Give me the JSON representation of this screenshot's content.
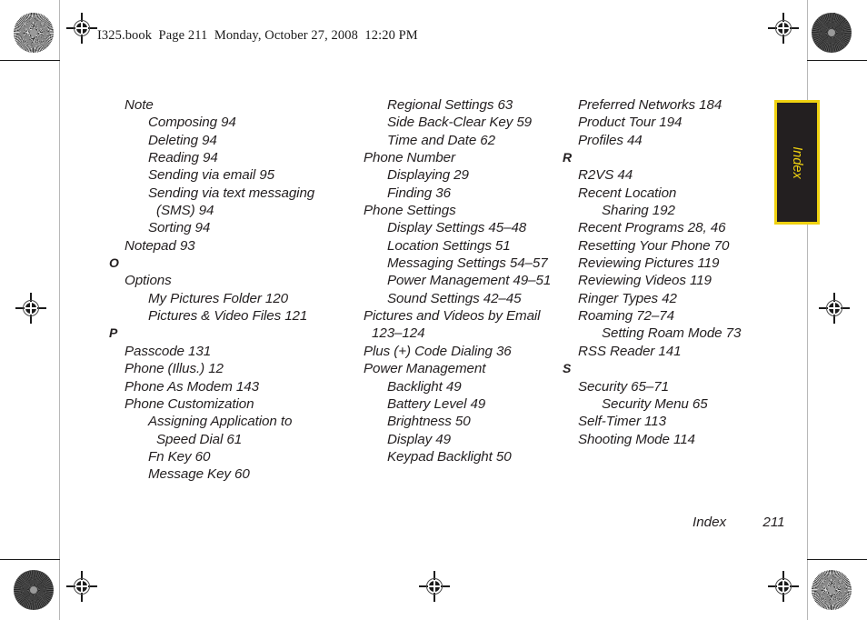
{
  "page": {
    "header_slug": "I325.book  Page 211  Monday, October 27, 2008  12:20 PM",
    "thumb_tab_label": "Index",
    "footer_section": "Index",
    "footer_page_number": "211",
    "colors": {
      "tab_background": "#231f20",
      "tab_border": "#efd110",
      "tab_text": "#efd110",
      "body_text": "#231f20"
    }
  },
  "columns": [
    {
      "id": "column-1",
      "blocks": [
        {
          "type": "entry",
          "level": 1,
          "text": "Note"
        },
        {
          "type": "entry",
          "level": 2,
          "text": "Composing 94"
        },
        {
          "type": "entry",
          "level": 2,
          "text": "Deleting 94"
        },
        {
          "type": "entry",
          "level": 2,
          "text": "Reading 94"
        },
        {
          "type": "entry",
          "level": 2,
          "text": "Sending via email 95"
        },
        {
          "type": "entry",
          "level": 2,
          "text": "Sending via text messaging"
        },
        {
          "type": "continuation",
          "level": 2,
          "text": "(SMS) 94"
        },
        {
          "type": "entry",
          "level": 2,
          "text": "Sorting 94"
        },
        {
          "type": "entry",
          "level": 1,
          "text": "Notepad 93"
        },
        {
          "type": "letter",
          "text": "O"
        },
        {
          "type": "entry",
          "level": 1,
          "text": "Options"
        },
        {
          "type": "entry",
          "level": 2,
          "text": "My Pictures Folder 120"
        },
        {
          "type": "entry",
          "level": 2,
          "text": "Pictures & Video Files 121"
        },
        {
          "type": "letter",
          "text": "P"
        },
        {
          "type": "entry",
          "level": 1,
          "text": "Passcode 131"
        },
        {
          "type": "entry",
          "level": 1,
          "text": "Phone (Illus.) 12"
        },
        {
          "type": "entry",
          "level": 1,
          "text": "Phone As Modem 143"
        },
        {
          "type": "entry",
          "level": 1,
          "text": "Phone Customization"
        },
        {
          "type": "entry",
          "level": 2,
          "text": "Assigning Application to"
        },
        {
          "type": "continuation",
          "level": 2,
          "text": "Speed Dial 61"
        },
        {
          "type": "entry",
          "level": 2,
          "text": "Fn Key 60"
        },
        {
          "type": "entry",
          "level": 2,
          "text": "Message Key 60"
        }
      ]
    },
    {
      "id": "column-2",
      "blocks": [
        {
          "type": "entry",
          "level": 2,
          "text": "Regional Settings 63"
        },
        {
          "type": "entry",
          "level": 2,
          "text": "Side Back-Clear Key 59"
        },
        {
          "type": "entry",
          "level": 2,
          "text": "Time and Date 62"
        },
        {
          "type": "entry",
          "level": 1,
          "text": "Phone Number"
        },
        {
          "type": "entry",
          "level": 2,
          "text": "Displaying 29"
        },
        {
          "type": "entry",
          "level": 2,
          "text": "Finding 36"
        },
        {
          "type": "entry",
          "level": 1,
          "text": "Phone Settings"
        },
        {
          "type": "entry",
          "level": 2,
          "text": "Display Settings 45–48"
        },
        {
          "type": "entry",
          "level": 2,
          "text": "Location Settings 51"
        },
        {
          "type": "entry",
          "level": 2,
          "text": "Messaging Settings 54–57"
        },
        {
          "type": "entry",
          "level": 2,
          "text": "Power Management 49–51"
        },
        {
          "type": "entry",
          "level": 2,
          "text": "Sound Settings 42–45"
        },
        {
          "type": "entry",
          "level": 1,
          "text": "Pictures and Videos by Email"
        },
        {
          "type": "continuation",
          "level": 1,
          "text": "123–124"
        },
        {
          "type": "entry",
          "level": 1,
          "text": "Plus (+) Code Dialing 36"
        },
        {
          "type": "entry",
          "level": 1,
          "text": "Power Management"
        },
        {
          "type": "entry",
          "level": 2,
          "text": "Backlight 49"
        },
        {
          "type": "entry",
          "level": 2,
          "text": "Battery Level 49"
        },
        {
          "type": "entry",
          "level": 2,
          "text": "Brightness 50"
        },
        {
          "type": "entry",
          "level": 2,
          "text": "Display 49"
        },
        {
          "type": "entry",
          "level": 2,
          "text": "Keypad Backlight 50"
        }
      ]
    },
    {
      "id": "column-3",
      "blocks": [
        {
          "type": "entry",
          "level": 1,
          "text": "Preferred Networks 184"
        },
        {
          "type": "entry",
          "level": 1,
          "text": "Product Tour 194"
        },
        {
          "type": "entry",
          "level": 1,
          "text": "Profiles 44"
        },
        {
          "type": "letter",
          "text": "R"
        },
        {
          "type": "entry",
          "level": 1,
          "text": "R2VS 44"
        },
        {
          "type": "entry",
          "level": 1,
          "text": "Recent Location"
        },
        {
          "type": "entry",
          "level": 2,
          "text": "Sharing 192"
        },
        {
          "type": "entry",
          "level": 1,
          "text": "Recent Programs 28, 46"
        },
        {
          "type": "entry",
          "level": 1,
          "text": "Resetting Your Phone 70"
        },
        {
          "type": "entry",
          "level": 1,
          "text": "Reviewing Pictures 119"
        },
        {
          "type": "entry",
          "level": 1,
          "text": "Reviewing Videos 119"
        },
        {
          "type": "entry",
          "level": 1,
          "text": "Ringer Types 42"
        },
        {
          "type": "entry",
          "level": 1,
          "text": "Roaming 72–74"
        },
        {
          "type": "entry",
          "level": 2,
          "text": "Setting Roam Mode 73"
        },
        {
          "type": "entry",
          "level": 1,
          "text": "RSS Reader 141"
        },
        {
          "type": "letter",
          "text": "S"
        },
        {
          "type": "entry",
          "level": 1,
          "text": "Security 65–71"
        },
        {
          "type": "entry",
          "level": 2,
          "text": "Security Menu 65"
        },
        {
          "type": "entry",
          "level": 1,
          "text": "Self-Timer 113"
        },
        {
          "type": "entry",
          "level": 1,
          "text": "Shooting Mode 114"
        }
      ]
    }
  ]
}
